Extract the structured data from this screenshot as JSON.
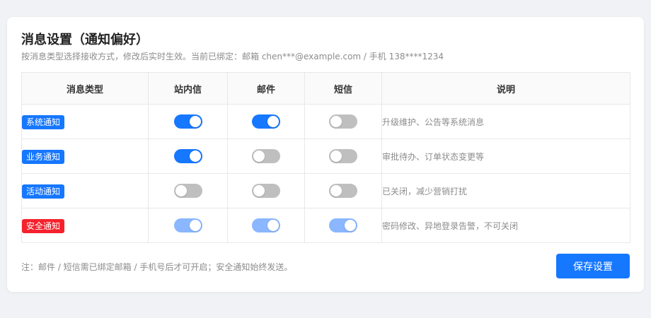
{
  "page": {
    "title": "消息设置（通知偏好）",
    "subtitle": "按消息类型选择接收方式，修改后实时生效。当前已绑定：邮箱 chen***@example.com  /  手机 138****1234"
  },
  "table": {
    "headers": [
      "消息类型",
      "站内信",
      "邮件",
      "短信",
      "说明"
    ],
    "rows": [
      {
        "type": "系统通知",
        "tag_color": "#1677ff",
        "site": true,
        "mail": true,
        "sms": false,
        "locked": false,
        "description": "升级维护、公告等系统消息"
      },
      {
        "type": "业务通知",
        "tag_color": "#1677ff",
        "site": true,
        "mail": false,
        "sms": false,
        "locked": false,
        "description": "审批待办、订单状态变更等"
      },
      {
        "type": "活动通知",
        "tag_color": "#1677ff",
        "site": false,
        "mail": false,
        "sms": false,
        "locked": false,
        "description": "已关闭，减少营销打扰"
      },
      {
        "type": "安全通知",
        "tag_color": "#f5222d",
        "site": true,
        "mail": true,
        "sms": true,
        "locked": true,
        "description": "密码修改、异地登录告警，不可关闭"
      }
    ]
  },
  "footer": {
    "note": "注：邮件 / 短信需已绑定邮箱 / 手机号后才可开启；安全通知始终发送。",
    "save_label": "保存设置"
  },
  "colors": {
    "accent": "#1677ff",
    "danger": "#f5222d",
    "toggle_off": "#bfbfbf",
    "toggle_disabled_on": "#8ab7ff"
  }
}
